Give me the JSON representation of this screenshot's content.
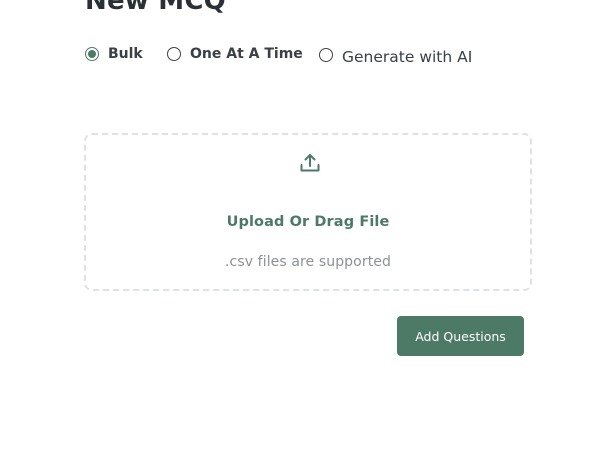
{
  "page": {
    "title": "New MCQ"
  },
  "mode_options": [
    {
      "label": "Bulk",
      "selected": true
    },
    {
      "label": "One At A Time",
      "selected": false
    },
    {
      "label": "Generate with AI",
      "selected": false
    }
  ],
  "upload": {
    "icon": "upload-icon",
    "title": "Upload Or Drag File",
    "hint": ".csv files are supported"
  },
  "actions": {
    "add_questions_label": "Add Questions"
  },
  "colors": {
    "accent": "#4c7a66",
    "text": "#2b3036",
    "muted": "#8d9195",
    "border": "#dfe2e4"
  }
}
